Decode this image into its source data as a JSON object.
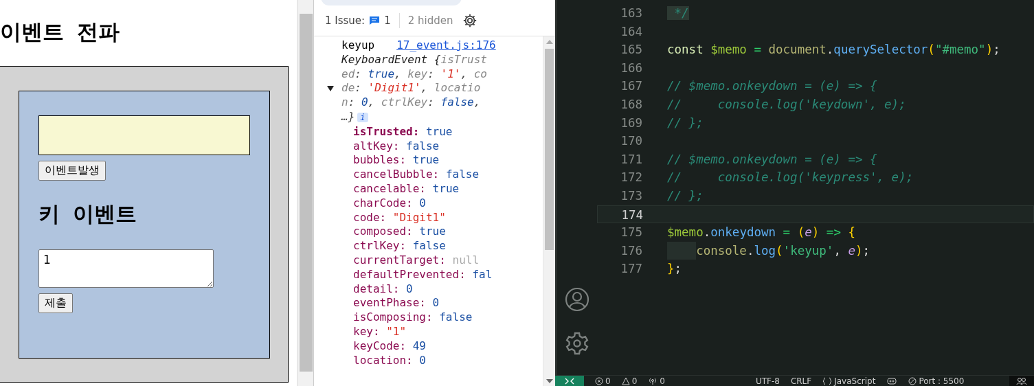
{
  "page": {
    "heading": "이벤트 전파",
    "event_button": "이벤트발생",
    "key_heading": "키 이벤트",
    "memo": {
      "value": "1"
    },
    "submit_button": "제출"
  },
  "devtools": {
    "issues": {
      "label": "1 Issue:",
      "count": "1",
      "hidden": "2 hidden"
    },
    "log": {
      "message": "keyup",
      "source": "17_event.js:176",
      "expanded": true,
      "summary": [
        {
          "kind": "type",
          "text": "KeyboardEvent {"
        },
        {
          "kind": "key",
          "text": "isTrusted"
        },
        {
          "kind": "punct",
          "text": ": "
        },
        {
          "kind": "keyword",
          "text": "true"
        },
        {
          "kind": "punct",
          "text": ", "
        },
        {
          "kind": "key",
          "text": "key"
        },
        {
          "kind": "punct",
          "text": ": "
        },
        {
          "kind": "string",
          "text": "'1'"
        },
        {
          "kind": "punct",
          "text": ", "
        },
        {
          "kind": "key",
          "text": "code"
        },
        {
          "kind": "punct",
          "text": ": "
        },
        {
          "kind": "string",
          "text": "'Digit1'"
        },
        {
          "kind": "punct",
          "text": ", "
        },
        {
          "kind": "key",
          "text": "location"
        },
        {
          "kind": "punct",
          "text": ": "
        },
        {
          "kind": "keyword",
          "text": "0"
        },
        {
          "kind": "punct",
          "text": ", "
        },
        {
          "kind": "key",
          "text": "ctrlKey"
        },
        {
          "kind": "punct",
          "text": ": "
        },
        {
          "kind": "keyword",
          "text": "false"
        },
        {
          "kind": "punct",
          "text": ", …}"
        }
      ],
      "info_badge": "i",
      "properties": [
        {
          "name": "isTrusted:",
          "value": "true",
          "kind": "keyword",
          "own": true
        },
        {
          "name": "altKey:",
          "value": "false",
          "kind": "keyword",
          "own": false
        },
        {
          "name": "bubbles:",
          "value": "true",
          "kind": "keyword",
          "own": false
        },
        {
          "name": "cancelBubble:",
          "value": "false",
          "kind": "keyword",
          "own": false
        },
        {
          "name": "cancelable:",
          "value": "true",
          "kind": "keyword",
          "own": false
        },
        {
          "name": "charCode:",
          "value": "0",
          "kind": "number",
          "own": false
        },
        {
          "name": "code:",
          "value": "\"Digit1\"",
          "kind": "string",
          "own": false
        },
        {
          "name": "composed:",
          "value": "true",
          "kind": "keyword",
          "own": false
        },
        {
          "name": "ctrlKey:",
          "value": "false",
          "kind": "keyword",
          "own": false
        },
        {
          "name": "currentTarget:",
          "value": "null",
          "kind": "null",
          "own": false
        },
        {
          "name": "defaultPrevented:",
          "value": "fal",
          "kind": "keyword",
          "own": false
        },
        {
          "name": "detail:",
          "value": "0",
          "kind": "number",
          "own": false
        },
        {
          "name": "eventPhase:",
          "value": "0",
          "kind": "number",
          "own": false
        },
        {
          "name": "isComposing:",
          "value": "false",
          "kind": "keyword",
          "own": false
        },
        {
          "name": "key:",
          "value": "\"1\"",
          "kind": "string",
          "own": false
        },
        {
          "name": "keyCode:",
          "value": "49",
          "kind": "number",
          "own": false
        },
        {
          "name": "location:",
          "value": "0",
          "kind": "number",
          "own": false
        }
      ]
    }
  },
  "editor": {
    "lines": [
      {
        "number": "163",
        "current": false,
        "indented": false,
        "tokens": [
          {
            "kind": "comment-sel",
            "text": " */"
          }
        ]
      },
      {
        "number": "164",
        "current": false,
        "indented": false
      },
      {
        "number": "165",
        "current": false,
        "indented": false,
        "tokens": [
          {
            "kind": "keyword",
            "text": "const "
          },
          {
            "kind": "var",
            "text": "$memo"
          },
          {
            "kind": "op",
            "text": " = "
          },
          {
            "kind": "object",
            "text": "document"
          },
          {
            "kind": "plain",
            "text": "."
          },
          {
            "kind": "method",
            "text": "querySelector"
          },
          {
            "kind": "paren",
            "text": "("
          },
          {
            "kind": "string",
            "text": "\"#memo\""
          },
          {
            "kind": "paren",
            "text": ")"
          },
          {
            "kind": "plain",
            "text": ";"
          }
        ]
      },
      {
        "number": "166",
        "current": false,
        "indented": false
      },
      {
        "number": "167",
        "current": false,
        "indented": false,
        "tokens": [
          {
            "kind": "comment",
            "text": "// $memo.onkeydown = (e) => {"
          }
        ]
      },
      {
        "number": "168",
        "current": false,
        "indented": false,
        "tokens": [
          {
            "kind": "comment",
            "text": "//     console.log('keydown', e);"
          }
        ]
      },
      {
        "number": "169",
        "current": false,
        "indented": false,
        "tokens": [
          {
            "kind": "comment",
            "text": "// };"
          }
        ]
      },
      {
        "number": "170",
        "current": false,
        "indented": false
      },
      {
        "number": "171",
        "current": false,
        "indented": false,
        "tokens": [
          {
            "kind": "comment",
            "text": "// $memo.onkeydown = (e) => {"
          }
        ]
      },
      {
        "number": "172",
        "current": false,
        "indented": false,
        "tokens": [
          {
            "kind": "comment",
            "text": "//     console.log('keypress', e);"
          }
        ]
      },
      {
        "number": "173",
        "current": false,
        "indented": false,
        "tokens": [
          {
            "kind": "comment",
            "text": "// };"
          }
        ]
      },
      {
        "number": "174",
        "current": true,
        "indented": false
      },
      {
        "number": "175",
        "current": false,
        "indented": false,
        "tokens": [
          {
            "kind": "var",
            "text": "$memo"
          },
          {
            "kind": "plain",
            "text": "."
          },
          {
            "kind": "method",
            "text": "onkeydown"
          },
          {
            "kind": "op",
            "text": " = "
          },
          {
            "kind": "paren",
            "text": "("
          },
          {
            "kind": "param",
            "text": "e"
          },
          {
            "kind": "paren",
            "text": ")"
          },
          {
            "kind": "op",
            "text": " => "
          },
          {
            "kind": "paren",
            "text": "{"
          }
        ]
      },
      {
        "number": "176",
        "current": false,
        "indented": true,
        "tokens": [
          {
            "kind": "object",
            "text": "console"
          },
          {
            "kind": "plain",
            "text": "."
          },
          {
            "kind": "method",
            "text": "log"
          },
          {
            "kind": "paren",
            "text": "("
          },
          {
            "kind": "string",
            "text": "'keyup'"
          },
          {
            "kind": "plain",
            "text": ", "
          },
          {
            "kind": "param",
            "text": "e"
          },
          {
            "kind": "paren",
            "text": ")"
          },
          {
            "kind": "plain",
            "text": ";"
          }
        ]
      },
      {
        "number": "177",
        "current": false,
        "indented": false,
        "tokens": [
          {
            "kind": "paren",
            "text": "}"
          },
          {
            "kind": "plain",
            "text": ";"
          }
        ]
      }
    ]
  },
  "status_bar": [
    {
      "kind": "errors",
      "text": "0"
    },
    {
      "kind": "warnings",
      "text": "0"
    },
    {
      "kind": "ports",
      "text": "0"
    },
    {
      "kind": "plain",
      "text": "UTF-8"
    },
    {
      "kind": "plain",
      "text": "CRLF"
    },
    {
      "kind": "language",
      "text": "JavaScript"
    },
    {
      "kind": "copilot"
    },
    {
      "kind": "live-server",
      "text": "Port : 5500"
    },
    {
      "kind": "accounts"
    }
  ]
}
